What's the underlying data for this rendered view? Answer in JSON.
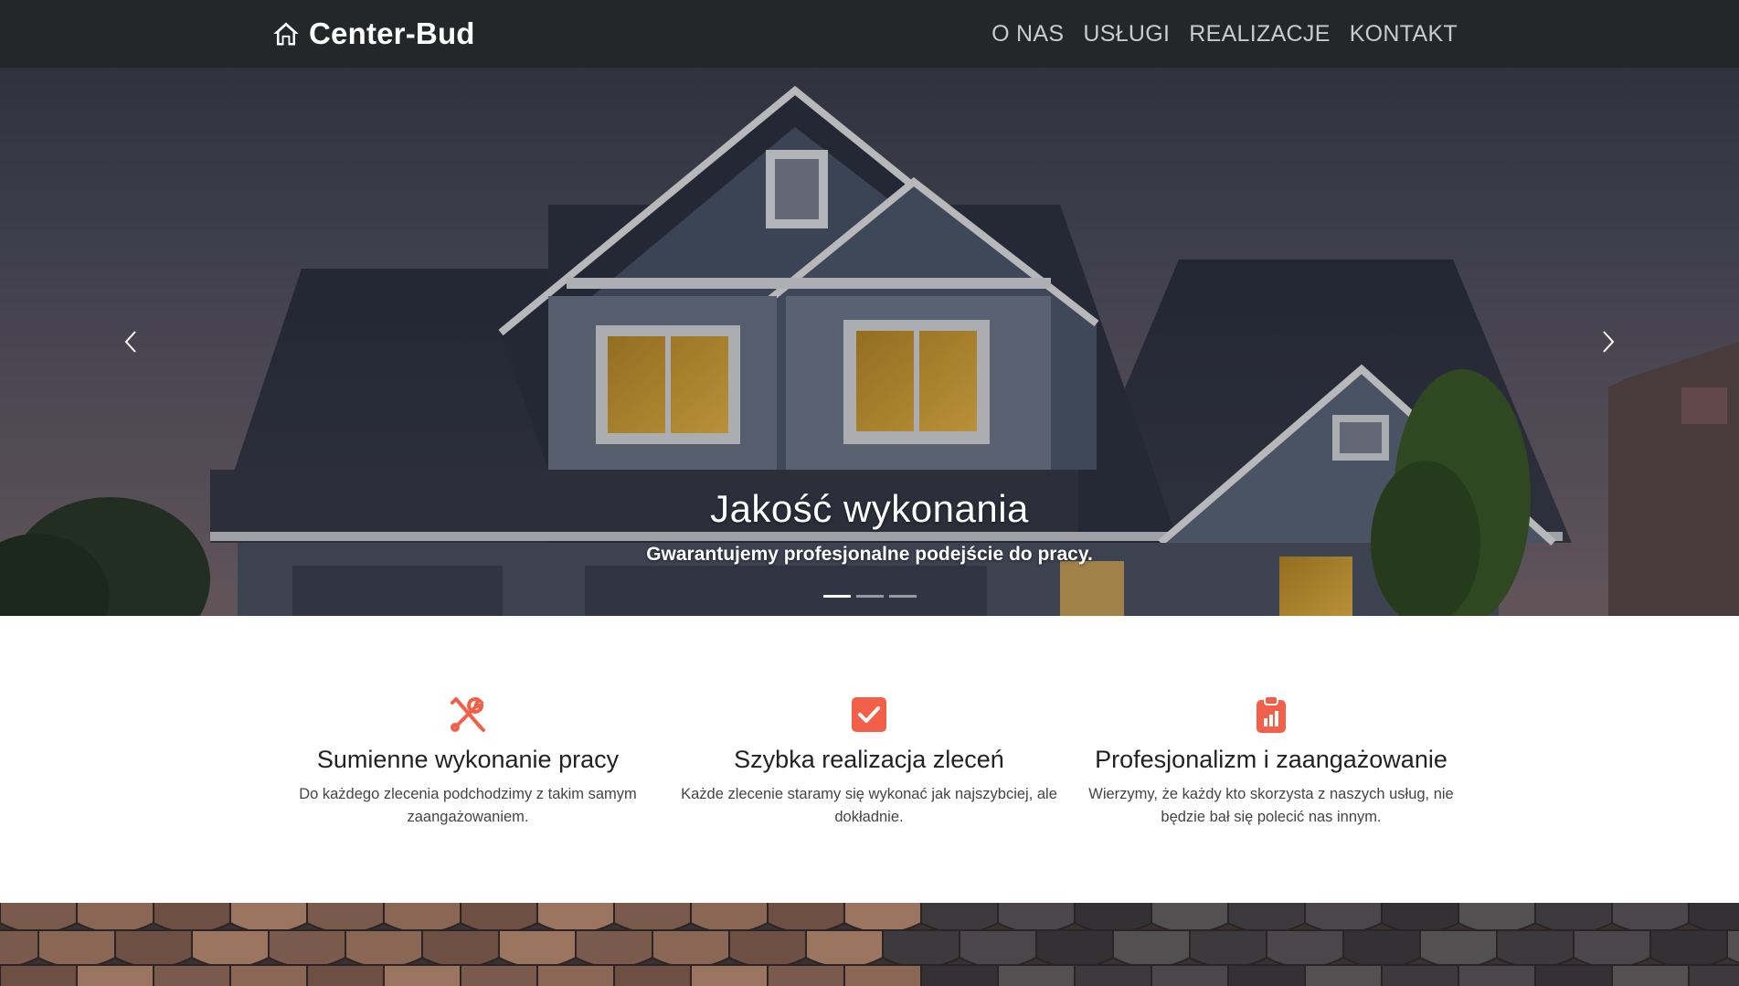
{
  "brand": {
    "name": "Center-Bud",
    "icon": "home-icon",
    "color": "#ffffff"
  },
  "nav": {
    "items": [
      "O NAS",
      "USŁUGI",
      "REALIZACJE",
      "KONTAKT"
    ]
  },
  "carousel": {
    "caption_title": "Jakość wykonania",
    "caption_text": "Gwarantujemy profesjonalne podejście do pracy.",
    "slide_count": 3,
    "active_slide": 1,
    "prev_icon": "chevron-left-icon",
    "next_icon": "chevron-right-icon"
  },
  "features": {
    "accent_color": "#f2604a",
    "items": [
      {
        "icon": "tools-icon",
        "title": "Sumienne wykonanie pracy",
        "text": "Do każdego zlecenia podchodzimy z takim samym zaangażowaniem."
      },
      {
        "icon": "checkbox-icon",
        "title": "Szybka realizacja zleceń",
        "text": "Każde zlecenie staramy się wykonać jak najszybciej, ale dokładnie."
      },
      {
        "icon": "clipboard-chart-icon",
        "title": "Profesjonalizm i zaangażowanie",
        "text": "Wierzymy, że każdy kto skorzysta z naszych usług, nie będzie bał się polecić nas innym."
      }
    ]
  }
}
